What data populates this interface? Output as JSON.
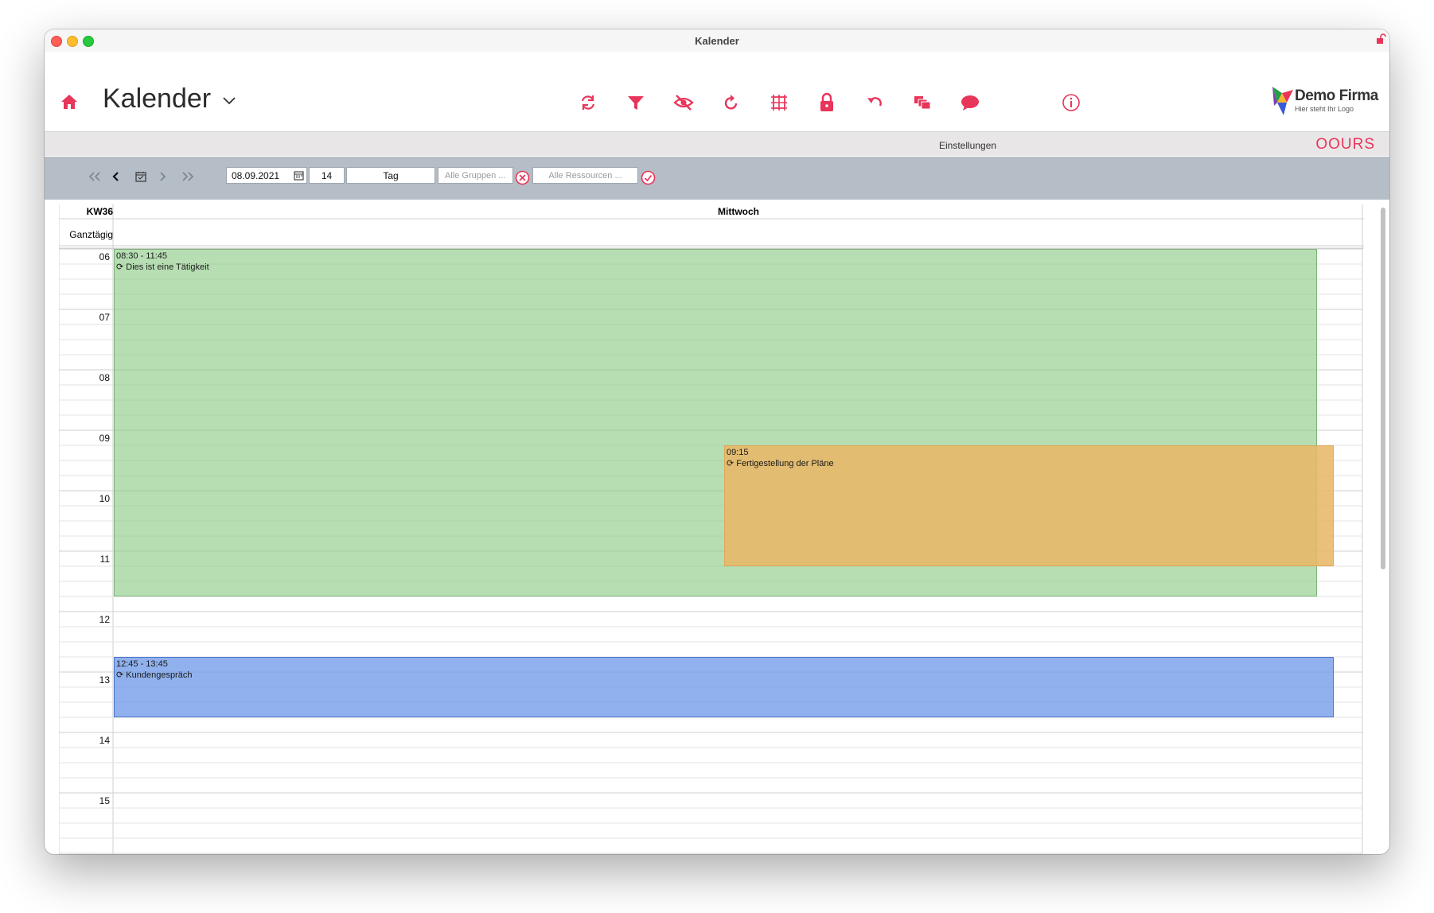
{
  "window": {
    "title": "Kalender"
  },
  "header": {
    "title": "Kalender",
    "toolbar_icons": [
      "sync-icon",
      "filter-icon",
      "hide-icon",
      "refresh-icon",
      "grid-icon",
      "lock-icon",
      "undo-icon",
      "windows-icon",
      "chat-icon",
      "info-icon"
    ]
  },
  "logo": {
    "name": "Demo Firma",
    "tagline": "Hier steht Ihr Logo"
  },
  "settings_strip": {
    "link": "Einstellungen",
    "brand": "OOURS"
  },
  "nav": {
    "date": "08.09.2021",
    "count": "14",
    "view": "Tag",
    "groups_placeholder": "Alle Gruppen ...",
    "resources_placeholder": "Alle Ressourcen ..."
  },
  "calendar": {
    "week": "KW36",
    "day": "Mittwoch",
    "allday_label": "Ganztägig",
    "hours": [
      "06",
      "07",
      "08",
      "09",
      "10",
      "11",
      "12",
      "13",
      "14",
      "15"
    ],
    "events": [
      {
        "time": "08:30 - 11:45",
        "title": "Dies ist eine Tätigkeit",
        "color": "#b5dbb0"
      },
      {
        "time": "09:15",
        "title": "Fertigestellung der Pläne",
        "color": "#ecc47f"
      },
      {
        "time": "12:45 - 13:45",
        "title": "Kundengespräch",
        "color": "#91b0ec"
      }
    ]
  },
  "colors": {
    "accent": "#e8355a",
    "nav_bar": "#b5bdc6"
  }
}
